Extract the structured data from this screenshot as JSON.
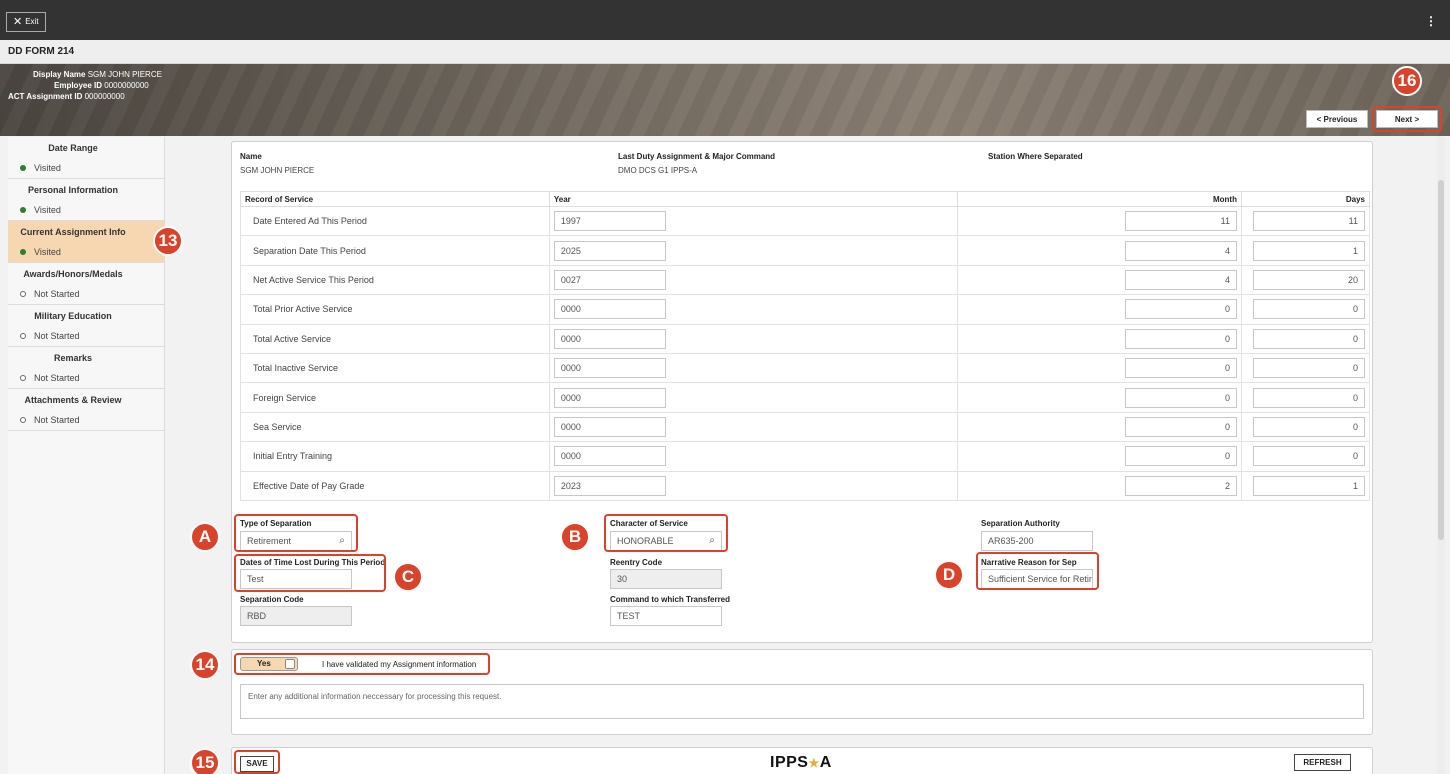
{
  "app": {
    "exit_label": "Exit",
    "menu_glyph": "⋮",
    "form_title": "DD FORM 214"
  },
  "header": {
    "display_name_label": "Display Name",
    "display_name": "SGM JOHN PIERCE",
    "employee_id_label": "Employee ID",
    "employee_id": "0000000000",
    "assignment_id_label": "ACT Assignment ID",
    "assignment_id": "000000000",
    "previous_label": "< Previous",
    "next_label": "Next >"
  },
  "callouts": {
    "c13": "13",
    "c14": "14",
    "c15": "15",
    "c16": "16",
    "a": "A",
    "b": "B",
    "c": "C",
    "d": "D"
  },
  "sidebar": {
    "steps": [
      {
        "title": "Date Range",
        "status": "Visited"
      },
      {
        "title": "Personal Information",
        "status": "Visited"
      },
      {
        "title": "Current Assignment Info",
        "status": "Visited"
      },
      {
        "title": "Awards/Honors/Medals",
        "status": "Not Started"
      },
      {
        "title": "Military Education",
        "status": "Not Started"
      },
      {
        "title": "Remarks",
        "status": "Not Started"
      },
      {
        "title": "Attachments & Review",
        "status": "Not Started"
      }
    ]
  },
  "summary": {
    "name_label": "Name",
    "name_value": "SGM JOHN PIERCE",
    "duty_label": "Last Duty Assignment & Major Command",
    "duty_value": "DMO DCS G1 IPPS-A",
    "station_label": "Station Where Separated"
  },
  "record": {
    "headers": {
      "record": "Record of Service",
      "year": "Year",
      "month": "Month",
      "days": "Days"
    },
    "rows": [
      {
        "label": "Date Entered Ad This Period",
        "year": "1997",
        "month": "11",
        "days": "11"
      },
      {
        "label": "Separation Date This Period",
        "year": "2025",
        "month": "4",
        "days": "1"
      },
      {
        "label": "Net Active Service This Period",
        "year": "0027",
        "month": "4",
        "days": "20"
      },
      {
        "label": "Total Prior Active Service",
        "year": "0000",
        "month": "0",
        "days": "0"
      },
      {
        "label": "Total Active Service",
        "year": "0000",
        "month": "0",
        "days": "0"
      },
      {
        "label": "Total Inactive Service",
        "year": "0000",
        "month": "0",
        "days": "0"
      },
      {
        "label": "Foreign Service",
        "year": "0000",
        "month": "0",
        "days": "0"
      },
      {
        "label": "Sea Service",
        "year": "0000",
        "month": "0",
        "days": "0"
      },
      {
        "label": "Initial Entry Training",
        "year": "0000",
        "month": "0",
        "days": "0"
      },
      {
        "label": "Effective Date of Pay Grade",
        "year": "2023",
        "month": "2",
        "days": "1"
      }
    ]
  },
  "separation": {
    "type_label": "Type of Separation",
    "type_value": "Retirement",
    "character_label": "Character of Service",
    "character_value": "HONORABLE",
    "authority_label": "Separation Authority",
    "authority_value": "AR635-200",
    "time_lost_label": "Dates of Time Lost During This Period",
    "time_lost_value": "Test",
    "reentry_label": "Reentry Code",
    "reentry_value": "30",
    "narrative_label": "Narrative Reason for Sep",
    "narrative_value": "Sufficient Service for Retir",
    "sep_code_label": "Separation Code",
    "sep_code_value": "RBD",
    "command_label": "Command to which Transferred",
    "command_value": "TEST"
  },
  "validation": {
    "toggle_label": "Yes",
    "statement": "I have validated my Assignment information",
    "notes_placeholder": "Enter any additional information neccessary for processing this request."
  },
  "footer": {
    "save_label": "SAVE",
    "refresh_label": "REFRESH",
    "logo_left": "IPPS",
    "logo_star": "★",
    "logo_right": "A"
  },
  "colors": {
    "accent_callout": "#d9432c",
    "active_step": "#f6d7b1",
    "visited_dot": "#2e7d32"
  }
}
